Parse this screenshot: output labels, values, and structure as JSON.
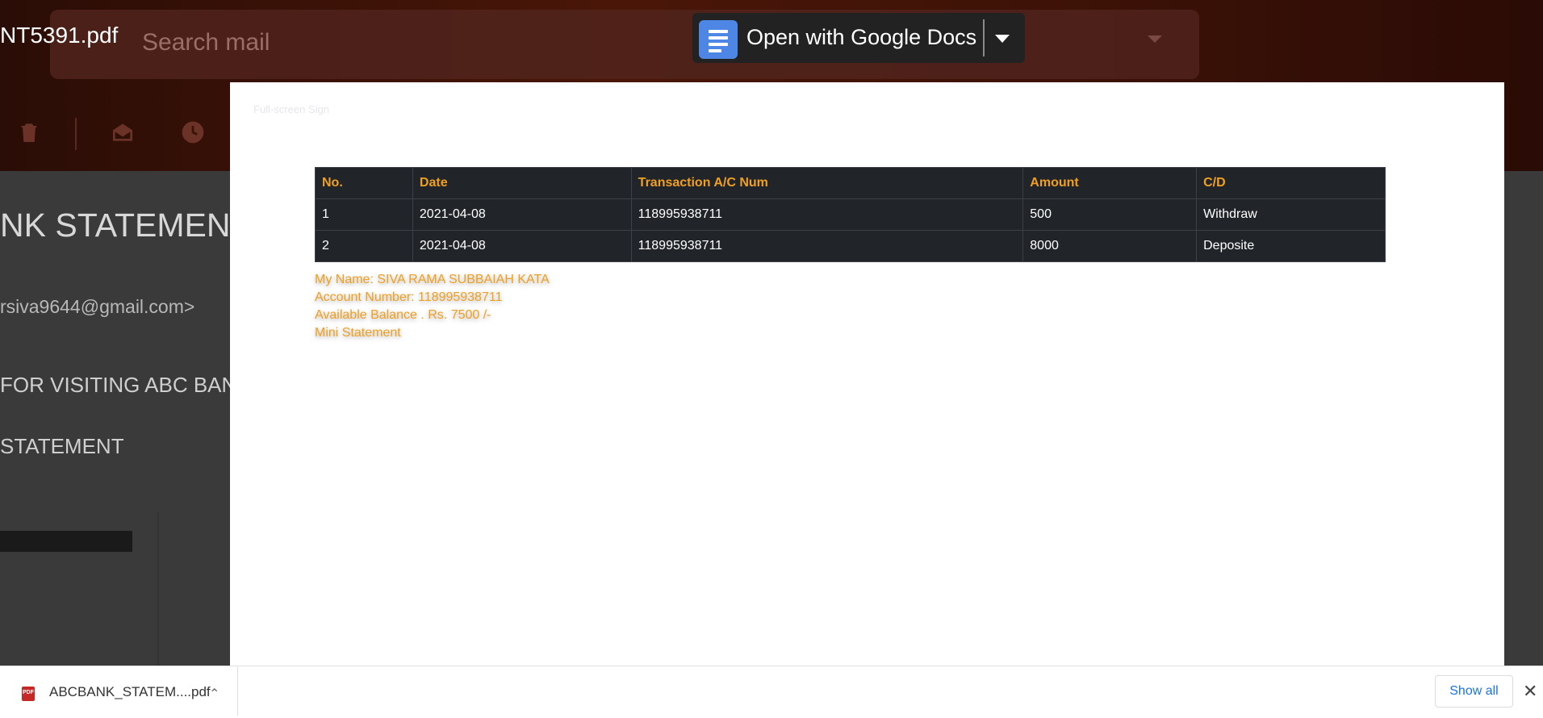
{
  "viewer": {
    "filename": "NT5391.pdf",
    "open_with_label": "Open with Google Docs",
    "fullscreen_hint": "Full-screen Sign"
  },
  "gmail": {
    "search_placeholder": "Search mail",
    "subject": "NK STATEMENT",
    "from": "rsiva9644@gmail.com>",
    "body_line1": "FOR VISITING ABC BAN",
    "body_line2": "STATEMENT"
  },
  "statement": {
    "headers": [
      "No.",
      "Date",
      "Transaction A/C Num",
      "Amount",
      "C/D"
    ],
    "rows": [
      [
        "1",
        "2021-04-08",
        "118995938711",
        "500",
        "Withdraw"
      ],
      [
        "2",
        "2021-04-08",
        "118995938711",
        "8000",
        "Deposite"
      ]
    ],
    "name_line": "My Name: SIVA RAMA SUBBAIAH KATA",
    "account_line": "Account Number: 118995938711",
    "balance_line": "Available Balance . Rs. 7500 /-",
    "mini_statement_line": "Mini Statement",
    "header_color": "#f0a020",
    "table_bg": "#212529"
  },
  "download_bar": {
    "file_name": "ABCBANK_STATEM....pdf",
    "show_all_label": "Show all",
    "file_icon": "pdf-icon"
  }
}
